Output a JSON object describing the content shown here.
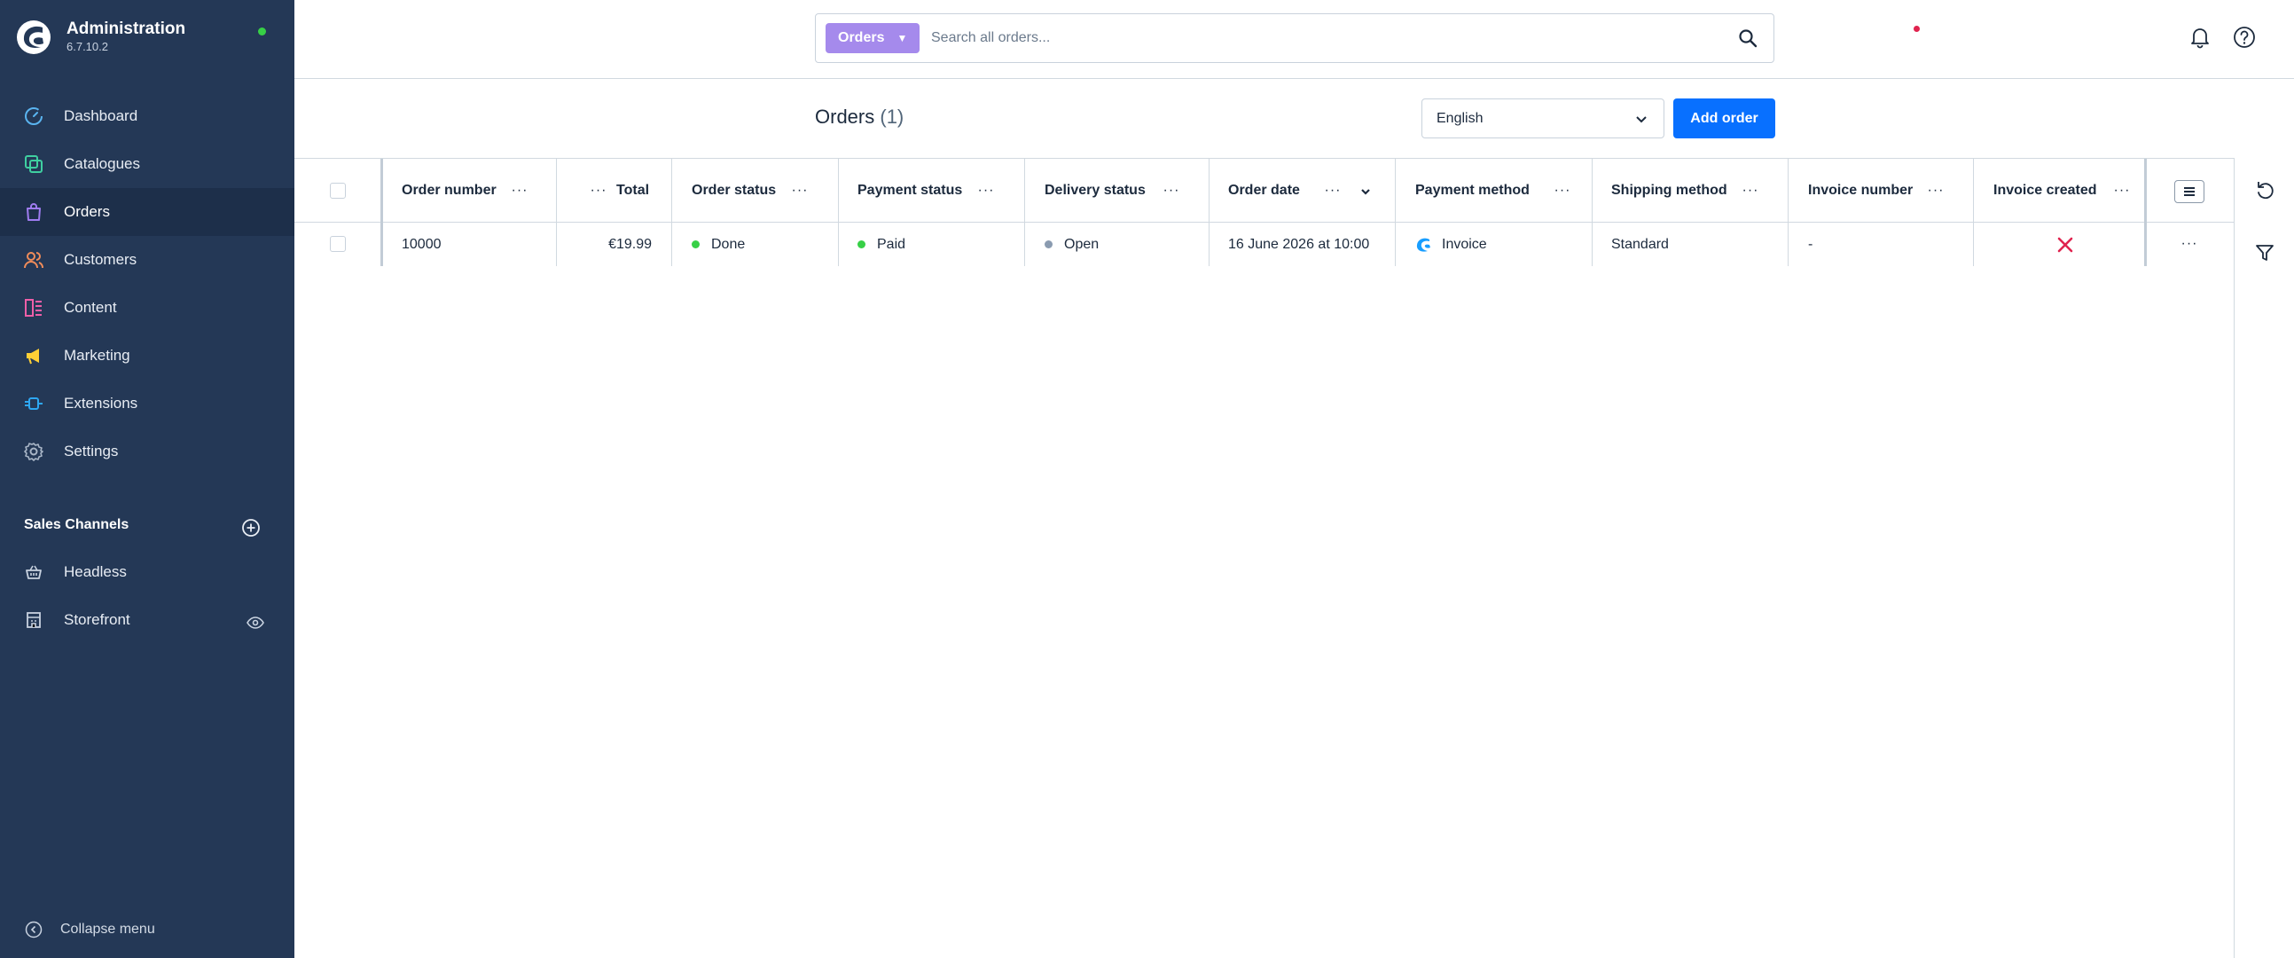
{
  "app": {
    "title": "Administration",
    "version": "6.7.10.2"
  },
  "nav": {
    "items": [
      {
        "label": "Dashboard",
        "icon": "dashboard-icon",
        "color": "#5ab4f0"
      },
      {
        "label": "Catalogues",
        "icon": "catalogues-icon",
        "color": "#3fcfa0"
      },
      {
        "label": "Orders",
        "icon": "orders-icon",
        "color": "#9f7cf0"
      },
      {
        "label": "Customers",
        "icon": "customers-icon",
        "color": "#f08c5a"
      },
      {
        "label": "Content",
        "icon": "content-icon",
        "color": "#ee5fa8"
      },
      {
        "label": "Marketing",
        "icon": "marketing-icon",
        "color": "#ffd036"
      },
      {
        "label": "Extensions",
        "icon": "extensions-icon",
        "color": "#2ea7f2"
      },
      {
        "label": "Settings",
        "icon": "settings-icon",
        "color": "#a8b5c6"
      }
    ],
    "active": "Orders"
  },
  "sales_channels": {
    "header": "Sales Channels",
    "items": [
      {
        "label": "Headless",
        "icon": "basket-icon"
      },
      {
        "label": "Storefront",
        "icon": "storefront-icon"
      }
    ]
  },
  "collapse_label": "Collapse menu",
  "search": {
    "type_label": "Orders",
    "placeholder": "Search all orders..."
  },
  "page": {
    "title": "Orders",
    "count": "(1)",
    "language": "English",
    "add_button": "Add order"
  },
  "colors": {
    "sidebar": "#243856",
    "primary": "#0870ff",
    "search_type": "#a58aec",
    "status_done": "#37d046",
    "status_paid": "#37d046",
    "status_open": "#8a9bb0",
    "invoice_no": "#e0234e"
  },
  "table": {
    "columns": [
      {
        "label": "Order number"
      },
      {
        "label": "Total"
      },
      {
        "label": "Order status"
      },
      {
        "label": "Payment status"
      },
      {
        "label": "Delivery status"
      },
      {
        "label": "Order date"
      },
      {
        "label": "Payment method"
      },
      {
        "label": "Shipping method"
      },
      {
        "label": "Invoice number"
      },
      {
        "label": "Invoice created"
      }
    ],
    "rows": [
      {
        "order_number": "10000",
        "total": "€19.99",
        "order_status": "Done",
        "payment_status": "Paid",
        "delivery_status": "Open",
        "order_date": "16 June 2026 at 10:00",
        "payment_method": "Invoice",
        "shipping_method": "Standard",
        "invoice_number": "-",
        "invoice_created": "x-icon"
      }
    ]
  }
}
